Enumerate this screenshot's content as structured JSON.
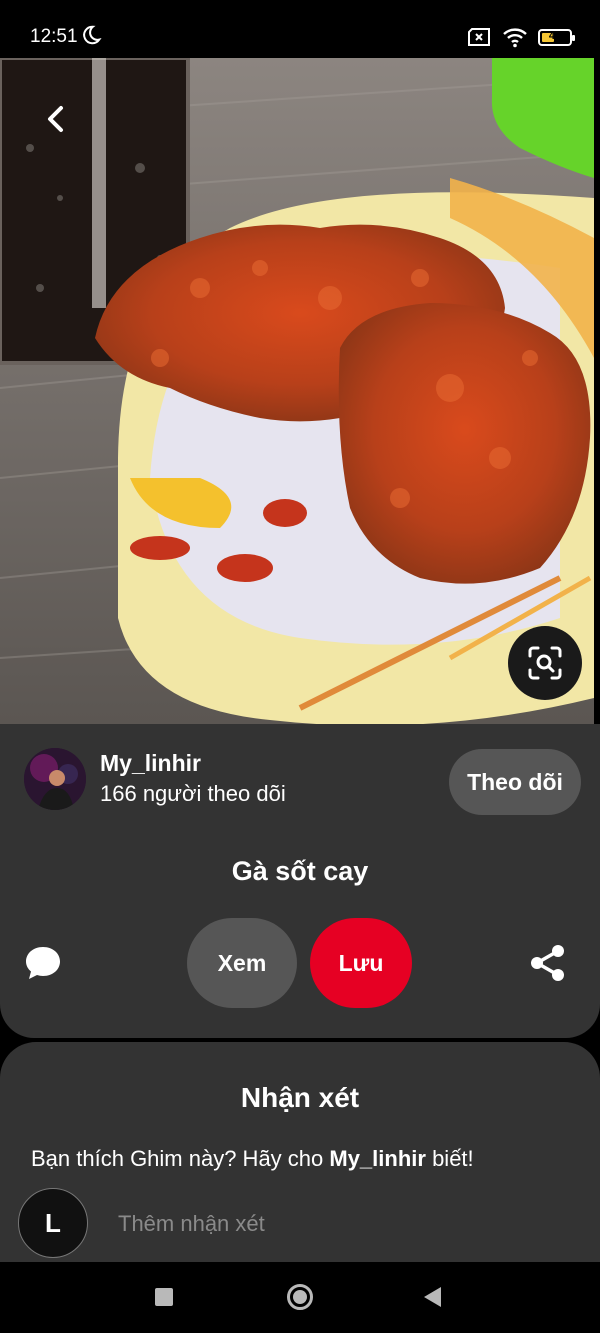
{
  "status_bar": {
    "time": "12:51",
    "battery_level": "40",
    "icons": [
      "moon-icon",
      "no-sim-icon",
      "wifi-icon",
      "battery-icon"
    ]
  },
  "pin": {
    "author": {
      "name": "My_linhir",
      "followers": "166 người theo dõi"
    },
    "follow_label": "Theo dõi",
    "title": "Gà sốt cay",
    "view_label": "Xem",
    "save_label": "Lưu"
  },
  "comments": {
    "title": "Nhận xét",
    "prompt_before": "Bạn thích Ghim này? Hãy cho ",
    "prompt_author": "My_linhir",
    "prompt_after": " biết!",
    "user_initial": "L",
    "input_placeholder": "Thêm nhận xét"
  },
  "colors": {
    "accent": "#e60023",
    "panel": "#333333",
    "button": "#565656"
  }
}
